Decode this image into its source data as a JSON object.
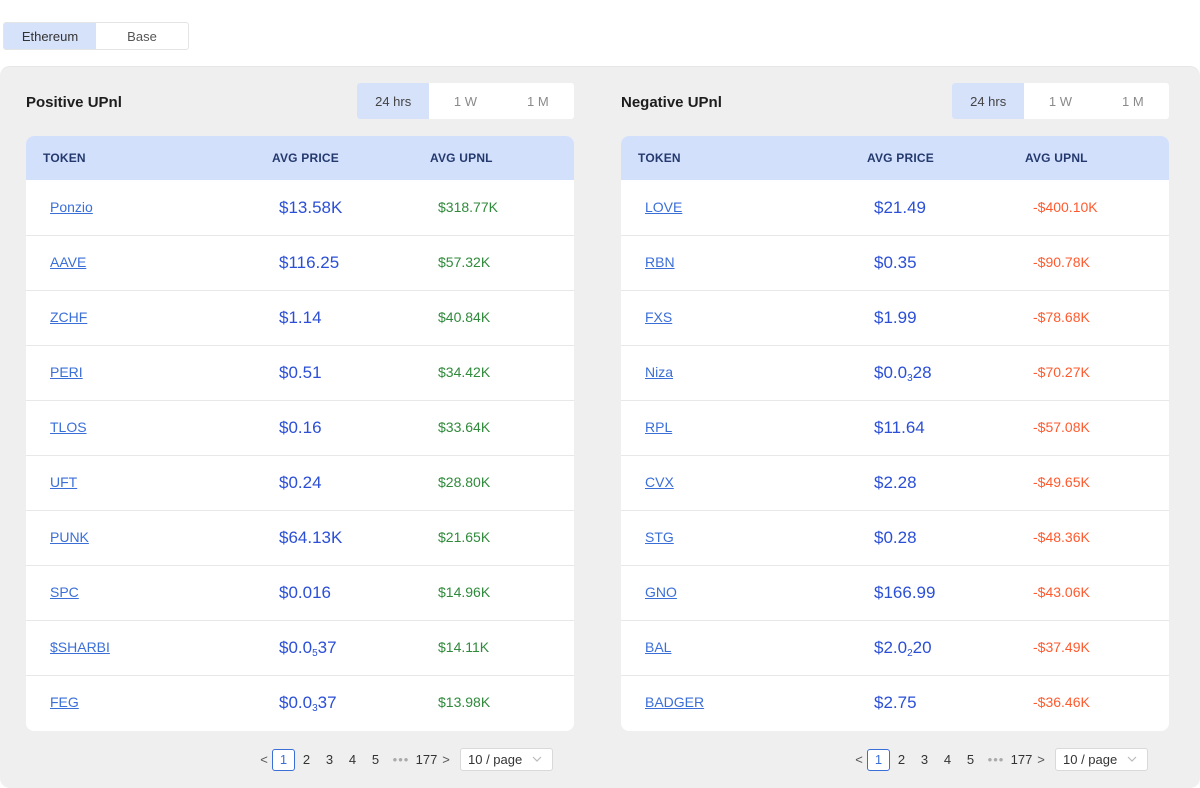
{
  "chain_tabs": [
    "Ethereum",
    "Base"
  ],
  "period_tabs": [
    "24 hrs",
    "1 W",
    "1 M"
  ],
  "columns": {
    "token": "TOKEN",
    "avg_price": "AVG PRICE",
    "avg_upnl": "AVG UPNL"
  },
  "positive": {
    "title": "Positive UPnl",
    "rows": [
      {
        "token": "Ponzio",
        "price": "$13.58K",
        "upnl": "$318.77K"
      },
      {
        "token": "AAVE",
        "price": "$116.25",
        "upnl": "$57.32K"
      },
      {
        "token": "ZCHF",
        "price": "$1.14",
        "upnl": "$40.84K"
      },
      {
        "token": "PERI",
        "price": "$0.51",
        "upnl": "$34.42K"
      },
      {
        "token": "TLOS",
        "price": "$0.16",
        "upnl": "$33.64K"
      },
      {
        "token": "UFT",
        "price": "$0.24",
        "upnl": "$28.80K"
      },
      {
        "token": "PUNK",
        "price": "$64.13K",
        "upnl": "$21.65K"
      },
      {
        "token": "SPC",
        "price": "$0.016",
        "upnl": "$14.96K"
      },
      {
        "token": "$SHARBI",
        "price_pre": "$0.0",
        "price_sub": "5",
        "price_post": "37",
        "upnl": "$14.11K"
      },
      {
        "token": "FEG",
        "price_pre": "$0.0",
        "price_sub": "3",
        "price_post": "37",
        "upnl": "$13.98K"
      }
    ]
  },
  "negative": {
    "title": "Negative UPnl",
    "rows": [
      {
        "token": "LOVE",
        "price": "$21.49",
        "upnl": "-$400.10K"
      },
      {
        "token": "RBN",
        "price": "$0.35",
        "upnl": "-$90.78K"
      },
      {
        "token": "FXS",
        "price": "$1.99",
        "upnl": "-$78.68K"
      },
      {
        "token": "Niza",
        "price_pre": "$0.0",
        "price_sub": "3",
        "price_post": "28",
        "upnl": "-$70.27K"
      },
      {
        "token": "RPL",
        "price": "$11.64",
        "upnl": "-$57.08K"
      },
      {
        "token": "CVX",
        "price": "$2.28",
        "upnl": "-$49.65K"
      },
      {
        "token": "STG",
        "price": "$0.28",
        "upnl": "-$48.36K"
      },
      {
        "token": "GNO",
        "price": "$166.99",
        "upnl": "-$43.06K"
      },
      {
        "token": "BAL",
        "price_pre": "$2.0",
        "price_sub": "2",
        "price_post": "20",
        "upnl": "-$37.49K"
      },
      {
        "token": "BADGER",
        "price": "$2.75",
        "upnl": "-$36.46K"
      }
    ]
  },
  "pagination": {
    "prev": "<",
    "next": ">",
    "pages": [
      "1",
      "2",
      "3",
      "4",
      "5"
    ],
    "dots": "•••",
    "last": "177",
    "current": "1",
    "page_size": "10 / page"
  },
  "colors": {
    "accent": "#3b6fd8",
    "positive": "#2f8a3b",
    "negative": "#ff5a2e",
    "header_bg": "#d3e0fc"
  }
}
